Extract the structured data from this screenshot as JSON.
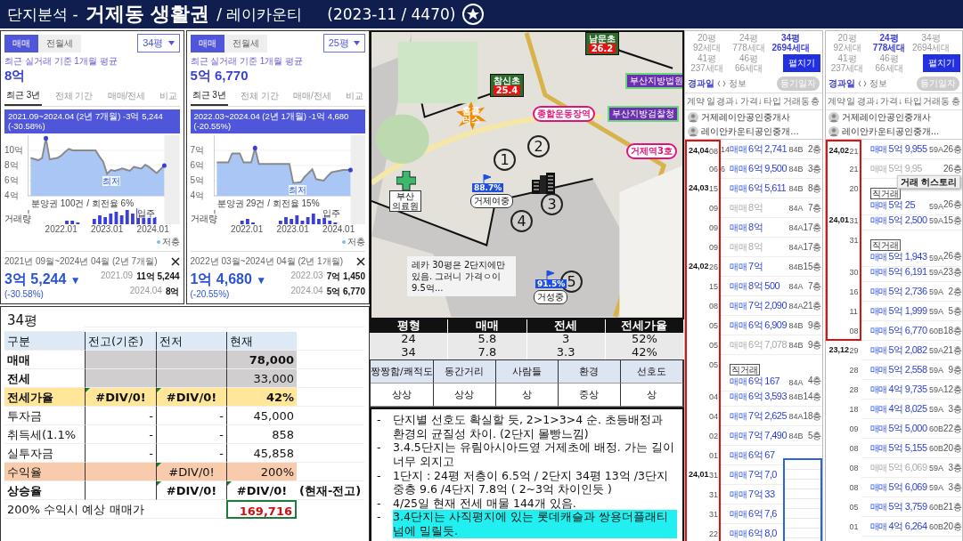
{
  "header": {
    "prefix": "단지분석 -",
    "area": "거제동 생활권",
    "complex": "/ 레이카운티",
    "period": "(2023-11 / 4470)"
  },
  "price_panels": [
    {
      "trade_tabs": [
        {
          "label": "매매",
          "selected": true
        },
        {
          "label": "전월세",
          "selected": false
        }
      ],
      "size_select": "34평",
      "avg_label": "최근 실거래 기준 1개월 평균",
      "avg_value": "8억",
      "period_tabs": [
        {
          "label": "최근 3년",
          "selected": true
        },
        {
          "label": "전체 기간",
          "selected": false
        },
        {
          "label": "매매/전세",
          "selected": false
        },
        {
          "label": "비교",
          "selected": false
        }
      ],
      "range_tooltip": "2021.09~2024.04 (2년 7개월)  -3억 5,244 (-30.58%)",
      "chart_data": {
        "type": "area",
        "grid": true,
        "categories": [
          null,
          null,
          null,
          null,
          null,
          null,
          null,
          null,
          "2022.01",
          null,
          null,
          null,
          null,
          null,
          null,
          null,
          null,
          null,
          null,
          null,
          "2023.01",
          null,
          null,
          null,
          null,
          null,
          null,
          null,
          null,
          null,
          null,
          null,
          "2024.01",
          null,
          null,
          null
        ],
        "series": [
          {
            "color": "#8a8a8a",
            "values": [
              9.0,
              8.85,
              8.7,
              9.0,
              11.6,
              8.8,
              8.9,
              9.0,
              9.3,
              9.8,
              10.2,
              10.0,
              10.0,
              10.0,
              10.0,
              10.0,
              10.0,
              10.0,
              9.2,
              8.5,
              6.9,
              7.4,
              7.3,
              7.45,
              7.6,
              7.45,
              7.3,
              7.8,
              7.7,
              7.6,
              8.1,
              7.8,
              7.4,
              7.0,
              7.5,
              8.0
            ]
          }
        ],
        "ylim": [
          4,
          12
        ],
        "yticks": [
          {
            "value": 10,
            "label": "10억"
          },
          {
            "value": 8,
            "label": "8억"
          },
          {
            "value": 6,
            "label": "6억"
          },
          {
            "value": 4,
            "label": "4억"
          }
        ]
      },
      "low_label": "최저",
      "presale_note": "분양권 100건 / 회전율 6%",
      "movein_label": "입주",
      "volume_label": "거래량",
      "legend": "저층",
      "range_title": "2021년 09월~2024년 04월 (2년 7개월)",
      "change": "3억 5,244",
      "change_arrow": "▼",
      "change_pct": "(-30.58%)",
      "from_date": "2021.09",
      "from_price": "11억 5,244",
      "to_date": "2024.04",
      "to_price": "8억"
    },
    {
      "trade_tabs": [
        {
          "label": "매매",
          "selected": true
        },
        {
          "label": "전월세",
          "selected": false
        }
      ],
      "size_select": "25평",
      "avg_label": "최근 실거래 기준 1개월 평균",
      "avg_value": "5억 6,770",
      "period_tabs": [
        {
          "label": "최근 3년",
          "selected": true
        },
        {
          "label": "전체 기간",
          "selected": false
        },
        {
          "label": "매매/전세",
          "selected": false
        },
        {
          "label": "비교",
          "selected": false
        }
      ],
      "range_tooltip": "2022.03~2024.04 (2년 1개월)  -1억 4,680 (-20.55%)",
      "chart_data": {
        "type": "area",
        "grid": true,
        "categories": [
          null,
          null,
          null,
          null,
          null,
          null,
          null,
          null,
          "2022.01",
          null,
          null,
          null,
          null,
          null,
          null,
          null,
          null,
          null,
          null,
          null,
          "2023.01",
          null,
          null,
          null,
          null,
          null,
          null,
          null,
          null,
          null,
          null,
          null,
          "2024.01",
          null,
          null,
          null
        ],
        "series": [
          {
            "color": "#8a8a8a",
            "values": [
              6.2,
              6.2,
              6.2,
              6.2,
              6.8,
              6.8,
              6.8,
              6.2,
              6.2,
              6.2,
              7.15,
              6.1,
              6.1,
              6.1,
              6.1,
              6.1,
              6.1,
              6.1,
              6.1,
              6.1,
              4.85,
              4.87,
              4.9,
              5.25,
              5.5,
              5.75,
              5.1,
              5.05,
              5.0,
              5.3,
              5.55,
              5.6,
              5.65,
              5.7,
              5.7,
              5.7
            ]
          }
        ],
        "ylim": [
          4,
          8
        ],
        "yticks": [
          {
            "value": 7,
            "label": "7억"
          },
          {
            "value": 6,
            "label": "6억"
          },
          {
            "value": 5,
            "label": "5억"
          },
          {
            "value": 4,
            "label": "4억"
          }
        ]
      },
      "low_label": "최저",
      "presale_note": "분양권 29건 / 회전율 15%",
      "movein_label": "입주",
      "volume_label": "거래량",
      "legend": "저층",
      "range_title": "2022년 03월~2024년 04월 (2년 1개월)",
      "change": "1억 4,680",
      "change_arrow": "▼",
      "change_pct": "(-20.55%)",
      "from_date": "2022.03",
      "from_price": "7억 1,450",
      "to_date": "2024.04",
      "to_price": "5억 6,770"
    }
  ],
  "sheet": {
    "title": "34평",
    "columns": [
      "구분",
      "전고(기준)",
      "전저",
      "현재"
    ],
    "rows": [
      {
        "label": "매매",
        "bold": true,
        "color": "#d0cece",
        "label_filled": false,
        "cells": [
          {},
          {},
          {
            "text": "78,000",
            "bold": true,
            "flagged": false
          }
        ]
      },
      {
        "label": "전세",
        "bold": true,
        "color": "#d0cece",
        "label_filled": false,
        "cells": [
          {},
          {},
          {
            "text": "33,000",
            "bold": false,
            "flagged": false
          }
        ]
      },
      {
        "label": "전세가율",
        "bold": true,
        "color": "#ffe699",
        "label_filled": true,
        "cells": [
          {
            "text": "#DIV/0!",
            "bold": true,
            "flagged": true
          },
          {
            "text": "#DIV/0!",
            "bold": true,
            "flagged": true
          },
          {
            "text": "42%",
            "bold": true,
            "flagged": false
          }
        ]
      },
      {
        "label": "투자금",
        "bold": false,
        "cells": [
          {
            "text": "-",
            "bold": false,
            "flagged": false
          },
          {
            "text": "-",
            "bold": false,
            "flagged": false
          },
          {
            "text": "45,000",
            "bold": false,
            "flagged": false
          }
        ]
      },
      {
        "label": "취득세(1.1%",
        "bold": false,
        "cells": [
          {
            "text": "-",
            "bold": false,
            "flagged": false
          },
          {
            "text": "-",
            "bold": false,
            "flagged": false
          },
          {
            "text": "858",
            "bold": false,
            "flagged": false
          }
        ]
      },
      {
        "label": "실투자금",
        "bold": false,
        "cells": [
          {
            "text": "-",
            "bold": false,
            "flagged": false
          },
          {
            "text": "-",
            "bold": false,
            "flagged": false
          },
          {
            "text": "45,858",
            "bold": false,
            "flagged": false
          }
        ]
      },
      {
        "label": "수익율",
        "bold": false,
        "color": "#f8cbad",
        "label_filled": true,
        "cells": [
          {},
          {
            "text": "#DIV/0!",
            "bold": false,
            "flagged": true
          },
          {
            "text": "200%",
            "bold": false,
            "flagged": false
          }
        ]
      },
      {
        "label": "상승율",
        "bold": true,
        "note": "(현재-전고)",
        "cells": [
          {},
          {
            "text": "#DIV/0!",
            "bold": true,
            "flagged": true
          },
          {
            "text": "#DIV/0!",
            "bold": true,
            "flagged": true
          }
        ]
      }
    ],
    "projection": {
      "label": "200% 수익시 예상 매매가",
      "value": "169,716"
    }
  },
  "map": {
    "schools": [
      {
        "name": "참신초",
        "score": "25.4"
      },
      {
        "name": "남문초",
        "score": "26.2"
      }
    ],
    "stations": [
      "종합운동장역",
      "거제역3호"
    ],
    "institutions": [
      "부산지방법원",
      "부산지방검찰청"
    ],
    "store": "홈플\n러스",
    "hospital": "부산\n의료원",
    "complex_numbers": [
      "1",
      "2",
      "3",
      "4",
      "5"
    ],
    "school_flags": [
      {
        "rate": "88.7%",
        "name": "거제여중"
      },
      {
        "rate": "91.5%",
        "name": "거성중"
      }
    ],
    "memo": "레카 30평은 2단지에만 있음. 그러니 가격ㅇ이 9.5억..."
  },
  "summary_table": {
    "columns": [
      "평형",
      "매매",
      "전세",
      "전세가율"
    ],
    "rows": [
      [
        "24",
        "5.8",
        "3",
        "52%"
      ],
      [
        "34",
        "7.8",
        "3.3",
        "42%"
      ]
    ]
  },
  "ratings": {
    "columns": [
      "짱짱함/쾌적도",
      "동간거리",
      "사람들",
      "환경",
      "선호도"
    ],
    "values": [
      "상상",
      "상상",
      "상",
      "중상",
      "상"
    ]
  },
  "notes": [
    {
      "bullet": "-",
      "text": "단지별 선호도 확실할 듯, 2>1>3>4 순. 초등배정과 환경의 균질성 차이. (2단지 몰빵느낌)",
      "highlighted": false
    },
    {
      "bullet": "-",
      "text": "3.4.5단지는 유림아시아드옆 거제초에 배정. 가는 길이 너무 외지고",
      "highlighted": false
    },
    {
      "bullet": "-",
      "text": "1단지 : 24평 저층이 6.5억 / 2단지 34평 13억 /3단지 중층 9.6 /4단지 7.8억 ( 2~3억 차이인듯 )",
      "highlighted": false
    },
    {
      "bullet": "-",
      "text": "4/25일 현재 전세 매물 144개 있음.",
      "highlighted": false
    },
    {
      "bullet": "-",
      "text": "3.4단지는 사직평지에 있는 롯데캐슬과 쌍용더플래티넘에 밀릴듯.",
      "highlighted": true
    }
  ],
  "listings": [
    {
      "size_tabs": [
        {
          "size": "20평",
          "households": "92세대",
          "selected": false
        },
        {
          "size": "24평",
          "households": "778세대",
          "selected": false
        },
        {
          "size": "34평",
          "households": "2694세대",
          "selected": true
        },
        {
          "size": "41평",
          "households": "237세대",
          "selected": false
        },
        {
          "size": "46평",
          "households": "66세대",
          "selected": false
        }
      ],
      "fold_button": "펼치기",
      "sort_label": "경과일",
      "info_label": "정보",
      "registry_button": "등기일자",
      "columns": [
        "계약",
        "일",
        "경과↓",
        "가격↓",
        "타입",
        "거래동",
        "층"
      ],
      "agents": [
        "거제레이안공인중개사",
        "레이안카운티공인중개…"
      ],
      "thumbnail_overlay": true,
      "rows": [
        {
          "month": "24,04",
          "day": "08",
          "elapsed": "14",
          "deal": "매매",
          "price": "6억 2,741",
          "type": "84B",
          "floor": "2층",
          "cancelled": false,
          "boxed": true
        },
        {
          "day": "06",
          "elapsed": "6",
          "deal": "매매",
          "price": "6억 9,500",
          "type": "84B",
          "floor": "3층",
          "cancelled": false,
          "boxed": true
        },
        {
          "month": "24,03",
          "day": "15",
          "deal": "매매",
          "price": "6억 5,611",
          "type": "84B",
          "floor": "8층",
          "cancelled": false,
          "boxed": true
        },
        {
          "day": "09",
          "deal": "매매",
          "price": "8억",
          "type": "84A",
          "floor": "7층",
          "cancelled": true,
          "boxed": true
        },
        {
          "day": "09",
          "deal": "매매",
          "price": "8억",
          "type": "84A",
          "floor": "17층",
          "cancelled": false,
          "boxed": true
        },
        {
          "day": "09",
          "deal": "매매",
          "price": "8억",
          "type": "84A",
          "floor": "17층",
          "cancelled": true,
          "boxed": true
        },
        {
          "month": "24,02",
          "day": "26",
          "deal": "매매",
          "price": "7억",
          "type": "84B",
          "floor": "15층",
          "cancelled": false,
          "boxed": true
        },
        {
          "day": "15",
          "deal": "매매",
          "price": "8억 500",
          "type": "84A",
          "floor": "7층",
          "cancelled": false,
          "boxed": true
        },
        {
          "day": "08",
          "deal": "매매",
          "price": "7억 2,090",
          "type": "84A",
          "floor": "21층",
          "cancelled": false,
          "boxed": true
        },
        {
          "day": "05",
          "deal": "매매",
          "price": "6억 6,909",
          "type": "84B",
          "floor": "9층",
          "cancelled": false,
          "boxed": true
        },
        {
          "day": "05",
          "deal": "매매",
          "price": "6억 7,078",
          "type": "84B",
          "floor": "9층",
          "cancelled": true,
          "boxed": true
        },
        {
          "day": "05",
          "tag": "직거래",
          "deal": "매매",
          "price": "6억 167",
          "type": "84A",
          "floor": "4층",
          "cancelled": false,
          "boxed": true
        },
        {
          "day": "04",
          "deal": "매매",
          "price": "6억 3,593",
          "type": "84B",
          "floor": "14층",
          "cancelled": false,
          "boxed": true
        },
        {
          "day": "04",
          "deal": "매매",
          "price": "7억 2,625",
          "type": "84A",
          "floor": "18층",
          "cancelled": false,
          "boxed": true
        },
        {
          "day": "02",
          "deal": "매매",
          "price": "7억 7,490",
          "type": "84B",
          "floor": "5층",
          "cancelled": false,
          "boxed": true
        },
        {
          "day": "01",
          "deal": "매매",
          "price": "6억 67",
          "cancelled": false,
          "boxed": true
        },
        {
          "month": "24,01",
          "day": "31",
          "deal": "매매",
          "price": "7억 7,0",
          "cancelled": false,
          "boxed": true
        },
        {
          "day": "31",
          "deal": "매매",
          "price": "7억 33",
          "cancelled": false,
          "boxed": true
        },
        {
          "day": "31",
          "deal": "매매",
          "price": "6억 7,6",
          "cancelled": false,
          "boxed": true
        },
        {
          "day": "22",
          "deal": "매매",
          "price": "6억 8,0",
          "cancelled": false,
          "boxed": true
        }
      ]
    },
    {
      "size_tabs": [
        {
          "size": "20평",
          "households": "92세대",
          "selected": false
        },
        {
          "size": "24평",
          "households": "778세대",
          "selected": true
        },
        {
          "size": "34평",
          "households": "2694세대",
          "selected": false
        },
        {
          "size": "41평",
          "households": "237세대",
          "selected": false
        },
        {
          "size": "46평",
          "households": "66세대",
          "selected": false
        }
      ],
      "fold_button": "펼치기",
      "sort_label": "경과일",
      "info_label": "정보",
      "registry_button": "등기일자",
      "columns": [
        "계약",
        "일",
        "경과↓",
        "가격↓",
        "타입",
        "거래동",
        "층"
      ],
      "agents": [
        "거제레이안공인중개사",
        "레이안카운티공인중개…"
      ],
      "thumbnail_overlay": false,
      "tooltip": "거래 히스토리",
      "rows": [
        {
          "month": "24,02",
          "day": "21",
          "deal": "매매",
          "price": "5억 9,955",
          "type": "59A",
          "floor": "26층",
          "cancelled": false,
          "boxed": true
        },
        {
          "day": "21",
          "deal": "매매",
          "price": "5억 9,95",
          "floor": "26층",
          "cancelled": true,
          "boxed": true
        },
        {
          "day": "20",
          "tag": "직거래",
          "deal": "매매",
          "price": "5억 25",
          "type": "59A",
          "floor": "26층",
          "cancelled": false,
          "boxed": true
        },
        {
          "month": "24,01",
          "day": "31",
          "deal": "매매",
          "price": "5억 2,500",
          "type": "59A",
          "floor": "15층",
          "cancelled": false,
          "boxed": true
        },
        {
          "day": "31",
          "tag": "직거래",
          "deal": "매매",
          "price": "5억 1,943",
          "type": "59A",
          "floor": "26층",
          "cancelled": false,
          "boxed": true
        },
        {
          "day": "30",
          "deal": "매매",
          "price": "5억 6,191",
          "type": "59A",
          "floor": "23층",
          "cancelled": false,
          "boxed": true
        },
        {
          "day": "16",
          "deal": "매매",
          "price": "5억 2,736",
          "type": "59A",
          "floor": "2층",
          "cancelled": false,
          "boxed": true
        },
        {
          "day": "11",
          "deal": "매매",
          "price": "5억 1,999",
          "type": "59A",
          "floor": "5층",
          "cancelled": false,
          "boxed": true
        },
        {
          "day": "08",
          "deal": "매매",
          "price": "5억 6,770",
          "type": "60B",
          "floor": "18층",
          "cancelled": false,
          "boxed": true
        },
        {
          "month": "23,12",
          "day": "29",
          "deal": "매매",
          "price": "5억 2,082",
          "type": "59A",
          "floor": "21층",
          "cancelled": false,
          "boxed": false
        },
        {
          "day": "28",
          "deal": "매매",
          "price": "5억 2,558",
          "type": "59A",
          "floor": "9층",
          "cancelled": false,
          "boxed": false
        },
        {
          "day": "28",
          "deal": "매매",
          "price": "4억 9,735",
          "type": "59A",
          "floor": "12층",
          "cancelled": false,
          "boxed": false
        },
        {
          "day": "18",
          "deal": "매매",
          "price": "4억 8,025",
          "type": "59A",
          "floor": "3층",
          "cancelled": false,
          "boxed": false
        },
        {
          "day": "09",
          "deal": "매매",
          "price": "5억 5,000",
          "type": "60B",
          "floor": "22층",
          "cancelled": false,
          "boxed": false
        },
        {
          "day": "08",
          "deal": "매매",
          "price": "5억 5,155",
          "type": "60B",
          "floor": "20층",
          "cancelled": false,
          "boxed": false
        },
        {
          "day": "08",
          "deal": "매매",
          "price": "5억 6,069",
          "type": "59A",
          "floor": "3층",
          "cancelled": true,
          "boxed": false
        },
        {
          "day": "08",
          "deal": "매매",
          "price": "5억 6,069",
          "type": "59A",
          "floor": "3층",
          "cancelled": false,
          "boxed": false
        },
        {
          "day": "05",
          "deal": "매매",
          "price": "5억 3,759",
          "type": "60B",
          "floor": "21층",
          "cancelled": false,
          "boxed": false
        },
        {
          "day": "01",
          "deal": "매매",
          "price": "4억 6,264",
          "type": "60B",
          "floor": "20층",
          "cancelled": false,
          "boxed": false
        }
      ]
    }
  ]
}
